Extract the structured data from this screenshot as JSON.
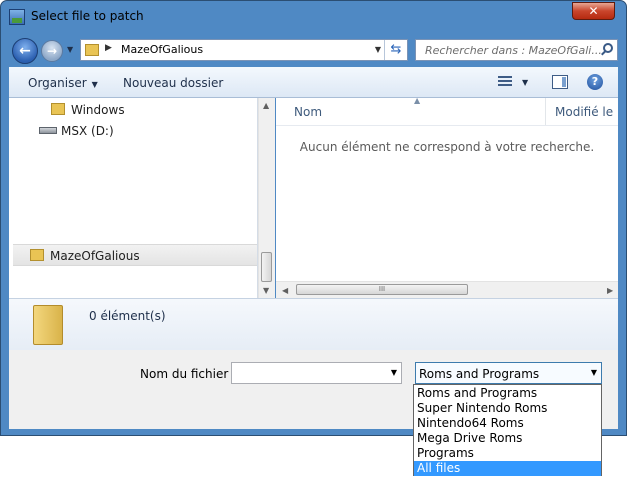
{
  "window": {
    "title": "Select file to patch",
    "close_glyph": "✕"
  },
  "nav": {
    "back_glyph": "←",
    "forward_glyph": "→"
  },
  "address": {
    "sep": "▶",
    "path": "MazeOfGalious",
    "refresh_glyph": "⇆"
  },
  "search": {
    "placeholder": "Rechercher dans : MazeOfGali..."
  },
  "toolbar": {
    "organize": "Organiser",
    "new_folder": "Nouveau dossier",
    "help": "?"
  },
  "sidebar": {
    "items": [
      {
        "label": "Windows",
        "icon": "folder-icon"
      },
      {
        "label": "MSX (D:)",
        "icon": "drive-icon"
      },
      {
        "label": "MazeOfGalious",
        "icon": "folder-icon"
      }
    ]
  },
  "list": {
    "columns": [
      "Nom",
      "Modifié le"
    ],
    "empty_message": "Aucun élément ne correspond à votre recherche.",
    "hscroll_grip": "III"
  },
  "details": {
    "count": "0 élément(s)"
  },
  "filename": {
    "label": "Nom du fichier :",
    "value": ""
  },
  "filetype": {
    "selected": "Roms and Programs",
    "options": [
      "Roms and Programs",
      "Super Nintendo Roms",
      "Nintendo64 Roms",
      "Mega Drive Roms",
      "Programs",
      "All files"
    ],
    "highlighted": "All files"
  },
  "colors": {
    "window_frame": "#4f89c4",
    "selection": "#3399ff",
    "close": "#c9452c"
  }
}
